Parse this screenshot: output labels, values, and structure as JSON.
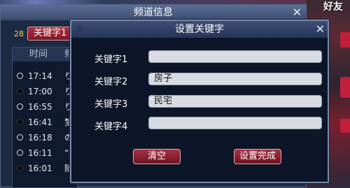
{
  "background": {
    "friend_text": "好友"
  },
  "channel_window": {
    "title": "频道信息",
    "close": "✕",
    "count": "28",
    "keyword_tab": "关键字1",
    "list": {
      "headers": [
        "时间",
        "频"
      ],
      "rows": [
        {
          "state": "empty",
          "time": "17:14",
          "channel": "り"
        },
        {
          "state": "filled",
          "time": "17:00",
          "channel": "り"
        },
        {
          "state": "empty",
          "time": "16:55",
          "channel": "り"
        },
        {
          "state": "filled",
          "time": "16:41",
          "channel": "梦"
        },
        {
          "state": "empty",
          "time": "16:18",
          "channel": "の"
        },
        {
          "state": "empty",
          "time": "16:11",
          "channel": "“"
        },
        {
          "state": "filled",
          "time": "16:01",
          "channel": "随"
        }
      ]
    }
  },
  "dialog": {
    "title": "设置关键字",
    "close": "✕",
    "fields": [
      {
        "label": "关键字1",
        "value": ""
      },
      {
        "label": "关键字2",
        "value": "房子"
      },
      {
        "label": "关键字3",
        "value": "民宅"
      },
      {
        "label": "关键字4",
        "value": ""
      }
    ],
    "clear_button": "清空",
    "done_button": "设置完成"
  },
  "colors": {
    "accent_red": "#a83042",
    "title_text": "#ffffff",
    "count_yellow": "#f4d35a"
  }
}
